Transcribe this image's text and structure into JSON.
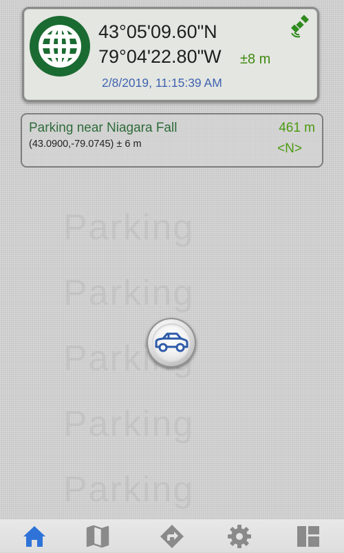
{
  "watermark": {
    "text": "Parking"
  },
  "position_card": {
    "latitude": "43°05'09.60\"N",
    "longitude": "79°04'22.80\"W",
    "accuracy": "±8 m",
    "datetime": "2/8/2019, 11:15:39 AM",
    "icons": {
      "globe": "globe-icon",
      "gps_status": "satellite-icon"
    },
    "colors": {
      "globe": "#1a6b32",
      "accuracy": "#3f8a0f",
      "datetime": "#3f63b0",
      "satellite": "#2f8a1f"
    }
  },
  "parking": {
    "name": "Parking near Niagara Fall",
    "coordinates": "(43.0900,-79.0745) ± 6 m",
    "distance": "461 m",
    "direction": "<N>",
    "colors": {
      "name": "#2e6b3a",
      "distance": "#4b9a10"
    }
  },
  "center_button": {
    "icon": "car-icon",
    "color": "#2d5aa8"
  },
  "bottom_nav": {
    "items": [
      {
        "icon": "home-icon",
        "active": true,
        "color": "#2f73d8"
      },
      {
        "icon": "map-icon",
        "active": false,
        "color": "#8a8a8a"
      },
      {
        "icon": "directions-icon",
        "active": false,
        "color": "#8a8a8a"
      },
      {
        "icon": "gear-icon",
        "active": false,
        "color": "#8a8a8a"
      },
      {
        "icon": "dashboard-icon",
        "active": false,
        "color": "#8a8a8a"
      }
    ]
  }
}
